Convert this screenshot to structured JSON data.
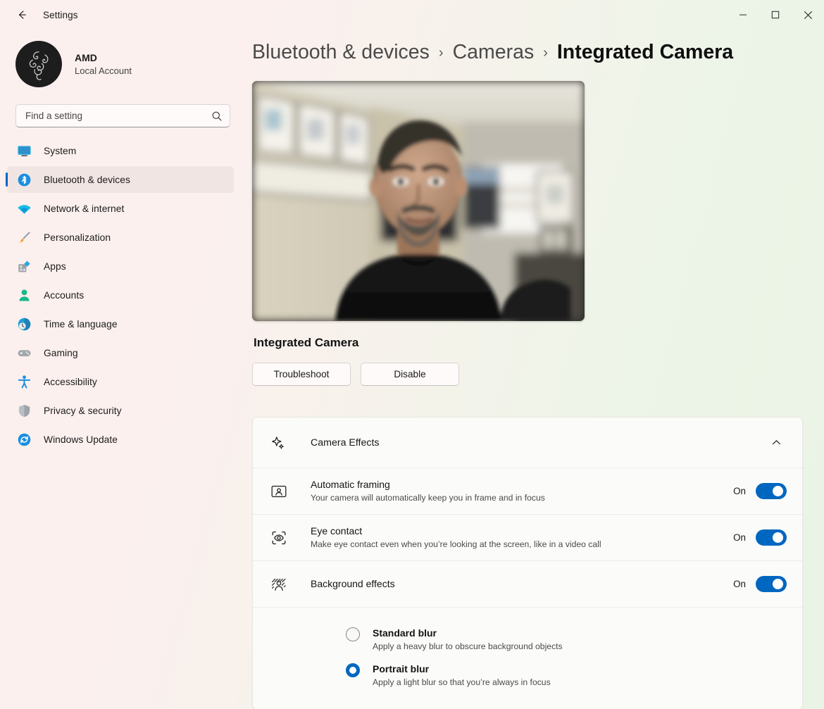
{
  "window": {
    "title": "Settings",
    "back_icon": "arrow-left-icon",
    "controls": {
      "minimize": "─",
      "maximize": "□",
      "close": "✕"
    }
  },
  "account": {
    "name": "AMD",
    "type": "Local Account",
    "avatar_icon": "razer-logo-avatar"
  },
  "search": {
    "placeholder": "Find a setting",
    "value": "",
    "icon": "search-icon"
  },
  "sidebar": {
    "items": [
      {
        "label": "System",
        "icon": "system-monitor-icon",
        "selected": false
      },
      {
        "label": "Bluetooth & devices",
        "icon": "bluetooth-icon",
        "selected": true
      },
      {
        "label": "Network & internet",
        "icon": "wifi-icon",
        "selected": false
      },
      {
        "label": "Personalization",
        "icon": "paintbrush-icon",
        "selected": false
      },
      {
        "label": "Apps",
        "icon": "apps-grid-icon",
        "selected": false
      },
      {
        "label": "Accounts",
        "icon": "person-icon",
        "selected": false
      },
      {
        "label": "Time & language",
        "icon": "clock-globe-icon",
        "selected": false
      },
      {
        "label": "Gaming",
        "icon": "gamepad-icon",
        "selected": false
      },
      {
        "label": "Accessibility",
        "icon": "accessibility-person-icon",
        "selected": false
      },
      {
        "label": "Privacy & security",
        "icon": "shield-icon",
        "selected": false
      },
      {
        "label": "Windows Update",
        "icon": "update-refresh-icon",
        "selected": false
      }
    ]
  },
  "main": {
    "breadcrumb": [
      {
        "label": "Bluetooth & devices",
        "current": false
      },
      {
        "label": "Cameras",
        "current": false
      },
      {
        "label": "Integrated Camera",
        "current": true
      }
    ],
    "breadcrumb_separator": "›",
    "preview": {
      "name": "camera-preview",
      "alt": "Live camera preview showing a person seated in a room with framed pictures on the wall"
    },
    "device_name": "Integrated Camera",
    "buttons": [
      {
        "label": "Troubleshoot",
        "name": "troubleshoot-button"
      },
      {
        "label": "Disable",
        "name": "disable-button"
      }
    ],
    "camera_effects": {
      "title": "Camera Effects",
      "icon": "sparkle-icon",
      "expanded": true,
      "chevron_icon": "chevron-up-icon",
      "rows": [
        {
          "title": "Automatic framing",
          "desc": "Your camera will automatically keep you in frame and in focus",
          "icon": "person-in-frame-icon",
          "state_label": "On",
          "on": true
        },
        {
          "title": "Eye contact",
          "desc": "Make eye contact even when you’re looking at the screen, like in a video call",
          "icon": "eye-focus-icon",
          "state_label": "On",
          "on": true
        },
        {
          "title": "Background effects",
          "desc": "",
          "icon": "background-blur-icon",
          "state_label": "On",
          "on": true
        }
      ],
      "blur_options": [
        {
          "title": "Standard blur",
          "desc": "Apply a heavy blur to obscure background objects",
          "checked": false
        },
        {
          "title": "Portrait blur",
          "desc": "Apply a light blur so that you’re always in focus",
          "checked": true
        }
      ]
    }
  },
  "colors": {
    "accent": "#0067c0",
    "sidebar_bg": "#fbf0ee",
    "content_bg": "#ebf4e6",
    "card_bg": "#fbfcf9"
  }
}
